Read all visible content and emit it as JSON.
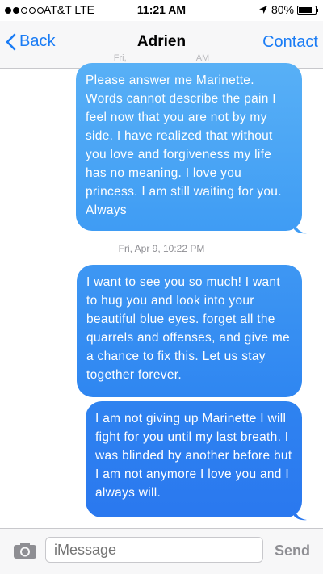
{
  "status": {
    "carrier": "AT&T LTE",
    "time": "11:21 AM",
    "battery": "80%",
    "battery_level": 0.8
  },
  "nav": {
    "back_label": "Back",
    "title": "Adrien",
    "contact_label": "Contact",
    "under_text": "Fri,",
    "under_text_right": "AM"
  },
  "messages": [
    {
      "text": "Please answer me Marinette. Words cannot describe the pain I feel now that you are not by my side. I have realized that without you love and forgiveness my life has no meaning. I love you princess. I am still waiting for you. Always"
    },
    {
      "timestamp": "Fri, Apr 9, 10:22 PM"
    },
    {
      "text": "I want to see you so much! I want to hug you and look into your beautiful blue eyes. forget all the quarrels and offenses, and give me a chance to fix this. Let us stay together forever."
    },
    {
      "text": "I am not giving up Marinette I will fight for you until my last breath. I was blinded by another before but I am not anymore I love you and I always will."
    }
  ],
  "input": {
    "placeholder": "iMessage",
    "send_label": "Send"
  },
  "colors": {
    "accent": "#1a7cf5",
    "bubble_top": "#58b0f6",
    "bubble_bottom": "#2a78ef"
  }
}
